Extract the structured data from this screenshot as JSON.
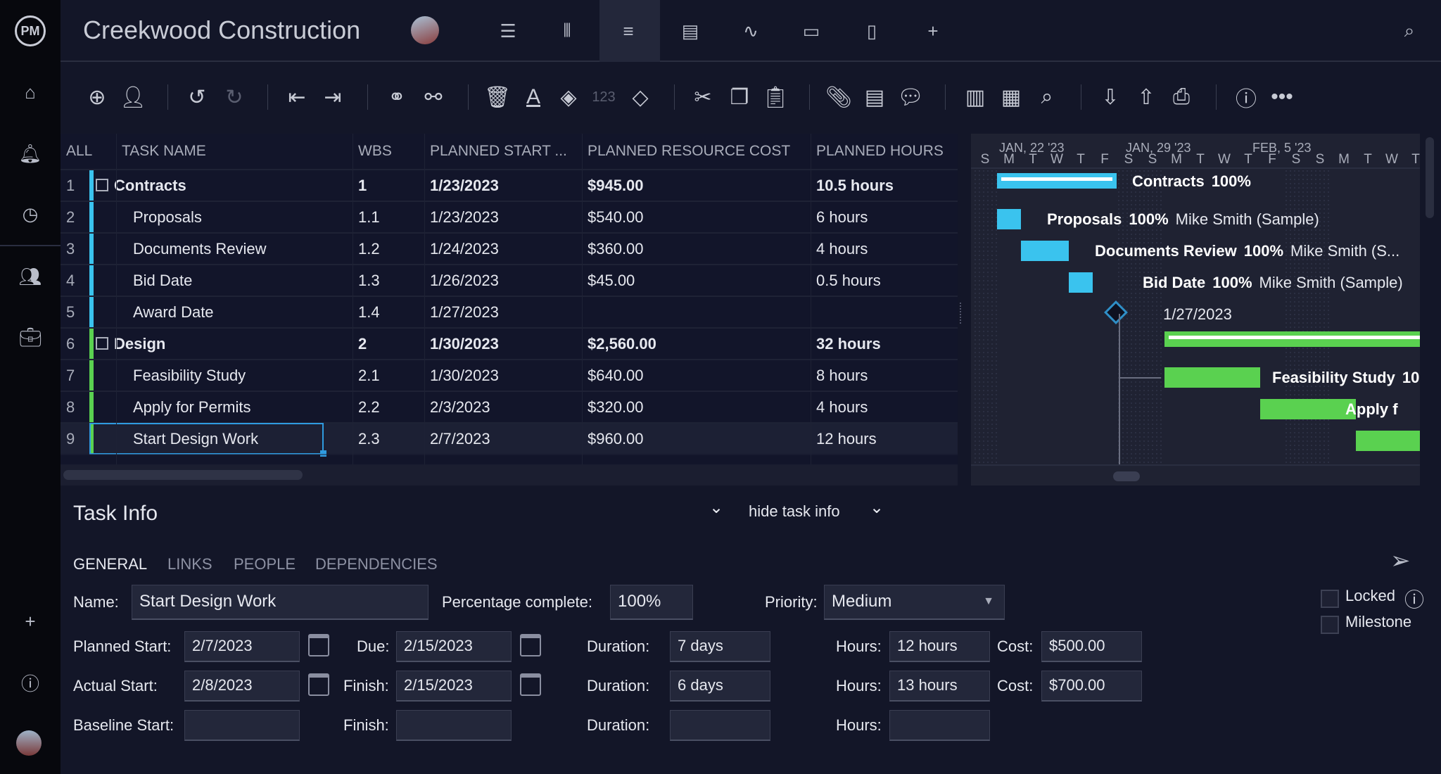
{
  "app": {
    "title": "Creekwood Construction",
    "logo": "PM"
  },
  "colors": {
    "contracts": "#3ac3ee",
    "design": "#5ad150",
    "accent": "#2f9be0",
    "background": "#131628"
  },
  "sidebar": {
    "icons": [
      "home-icon",
      "notifications-icon",
      "clock-icon",
      "people-icon",
      "briefcase-icon",
      "plus-icon",
      "help-icon",
      "user-avatar"
    ]
  },
  "views": [
    "list-view-icon",
    "board-view-icon",
    "gantt-view-icon",
    "sheet-view-icon",
    "dashboard-view-icon",
    "calendar-view-icon",
    "files-view-icon",
    "add-view-icon"
  ],
  "toolbar": {
    "number_format": "123"
  },
  "grid": {
    "headers": [
      "ALL",
      "TASK NAME",
      "WBS",
      "PLANNED START ...",
      "PLANNED RESOURCE COST",
      "PLANNED HOURS"
    ],
    "rows": [
      {
        "num": "1",
        "name": "Contracts",
        "wbs": "1",
        "start": "1/23/2023",
        "cost": "$945.00",
        "hours": "10.5 hours",
        "summary": true,
        "group": "contracts"
      },
      {
        "num": "2",
        "name": "Proposals",
        "wbs": "1.1",
        "start": "1/23/2023",
        "cost": "$540.00",
        "hours": "6 hours",
        "group": "contracts"
      },
      {
        "num": "3",
        "name": "Documents Review",
        "wbs": "1.2",
        "start": "1/24/2023",
        "cost": "$360.00",
        "hours": "4 hours",
        "group": "contracts"
      },
      {
        "num": "4",
        "name": "Bid Date",
        "wbs": "1.3",
        "start": "1/26/2023",
        "cost": "$45.00",
        "hours": "0.5 hours",
        "group": "contracts"
      },
      {
        "num": "5",
        "name": "Award Date",
        "wbs": "1.4",
        "start": "1/27/2023",
        "cost": "",
        "hours": "",
        "group": "contracts"
      },
      {
        "num": "6",
        "name": "Design",
        "wbs": "2",
        "start": "1/30/2023",
        "cost": "$2,560.00",
        "hours": "32 hours",
        "summary": true,
        "group": "design"
      },
      {
        "num": "7",
        "name": "Feasibility Study",
        "wbs": "2.1",
        "start": "1/30/2023",
        "cost": "$640.00",
        "hours": "8 hours",
        "group": "design"
      },
      {
        "num": "8",
        "name": "Apply for Permits",
        "wbs": "2.2",
        "start": "2/3/2023",
        "cost": "$320.00",
        "hours": "4 hours",
        "group": "design"
      },
      {
        "num": "9",
        "name": "Start Design Work",
        "wbs": "2.3",
        "start": "2/7/2023",
        "cost": "$960.00",
        "hours": "12 hours",
        "group": "design",
        "selected": true
      }
    ]
  },
  "gantt": {
    "weeks": [
      "JAN, 22 '23",
      "JAN, 29 '23",
      "FEB, 5 '23"
    ],
    "days": [
      "S",
      "M",
      "T",
      "W",
      "T",
      "F",
      "S",
      "S",
      "M",
      "T",
      "W",
      "T",
      "F",
      "S",
      "S",
      "M",
      "T",
      "W",
      "T"
    ],
    "labels": [
      {
        "name": "Contracts",
        "pct": "100%",
        "who": ""
      },
      {
        "name": "Proposals",
        "pct": "100%",
        "who": "Mike Smith (Sample)"
      },
      {
        "name": "Documents Review",
        "pct": "100%",
        "who": "Mike Smith (S..."
      },
      {
        "name": "Bid Date",
        "pct": "100%",
        "who": "Mike Smith (Sample)"
      },
      {
        "name": "",
        "pct": "",
        "who": "1/27/2023"
      },
      {
        "name": "",
        "pct": "",
        "who": ""
      },
      {
        "name": "Feasibility Study",
        "pct": "10",
        "who": ""
      },
      {
        "name": "Apply f",
        "pct": "",
        "who": ""
      },
      {
        "name": "",
        "pct": "",
        "who": ""
      }
    ]
  },
  "taskinfo": {
    "title": "Task Info",
    "hide": "hide task info",
    "tabs": [
      "GENERAL",
      "LINKS",
      "PEOPLE",
      "DEPENDENCIES"
    ],
    "name_label": "Name:",
    "name": "Start Design Work",
    "pct_label": "Percentage complete:",
    "pct": "100%",
    "priority_label": "Priority:",
    "priority": "Medium",
    "planned_start_label": "Planned Start:",
    "planned_start": "2/7/2023",
    "due_label": "Due:",
    "due": "2/15/2023",
    "duration_label": "Duration:",
    "planned_duration": "7 days",
    "hours_label": "Hours:",
    "planned_hours": "12 hours",
    "cost_label": "Cost:",
    "planned_cost": "$500.00",
    "actual_start_label": "Actual Start:",
    "actual_start": "2/8/2023",
    "finish_label": "Finish:",
    "actual_finish": "2/15/2023",
    "actual_duration": "6 days",
    "actual_hours": "13 hours",
    "actual_cost": "$700.00",
    "baseline_start_label": "Baseline Start:",
    "baseline_start": "",
    "baseline_finish": "",
    "baseline_duration": "",
    "baseline_hours": "",
    "locked_label": "Locked",
    "milestone_label": "Milestone"
  }
}
